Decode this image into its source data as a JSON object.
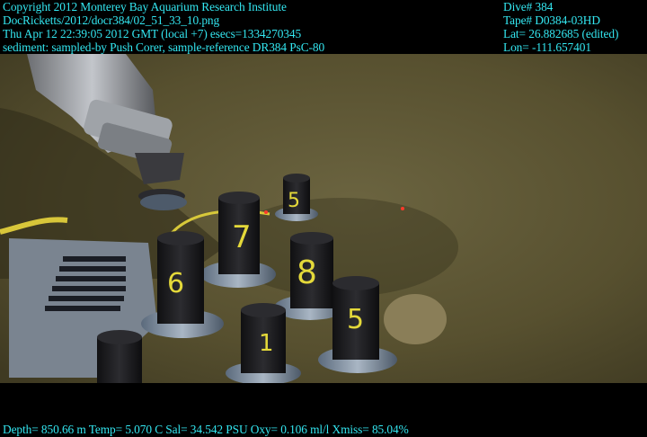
{
  "header_left": [
    "Copyright 2012 Monterey Bay Aquarium Research Institute",
    "DocRicketts/2012/docr384/02_51_33_10.png",
    "Thu Apr 12 22:39:05 2012 GMT (local +7)  esecs=1334270345",
    "sediment: sampled-by Push Corer, sample-reference DR384 PsC-80"
  ],
  "header_right": [
    "Dive# 384",
    "Tape# D0384-03HD",
    "Lat= 26.882685 (edited)",
    "Lon= -111.657401"
  ],
  "footer": "Depth= 850.66 m  Temp= 5.070 C  Sal= 34.542 PSU  Oxy= 0.106 ml/l  Xmiss= 85.04%",
  "core_labels": [
    "7",
    "5",
    "6",
    "8",
    "5",
    "1"
  ],
  "colors": {
    "overlay_text": "#33e6f0",
    "sediment": "#5a5434",
    "tube_black": "#1c1c1e"
  }
}
